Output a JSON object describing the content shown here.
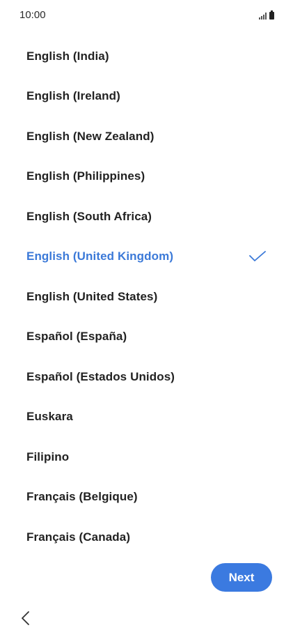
{
  "status_bar": {
    "time": "10:00",
    "icons": [
      "signal-icon",
      "battery-icon"
    ]
  },
  "languages": {
    "items": [
      {
        "label": "English (India)",
        "selected": false
      },
      {
        "label": "English (Ireland)",
        "selected": false
      },
      {
        "label": "English (New Zealand)",
        "selected": false
      },
      {
        "label": "English (Philippines)",
        "selected": false
      },
      {
        "label": "English (South Africa)",
        "selected": false
      },
      {
        "label": "English (United Kingdom)",
        "selected": true
      },
      {
        "label": "English (United States)",
        "selected": false
      },
      {
        "label": "Español (España)",
        "selected": false
      },
      {
        "label": "Español (Estados Unidos)",
        "selected": false
      },
      {
        "label": "Euskara",
        "selected": false
      },
      {
        "label": "Filipino",
        "selected": false
      },
      {
        "label": "Français (Belgique)",
        "selected": false
      },
      {
        "label": "Français (Canada)",
        "selected": false
      }
    ]
  },
  "footer": {
    "next_label": "Next",
    "back_icon": "chevron-left-icon"
  },
  "colors": {
    "accent": "#3b79d8",
    "button_bg": "#3b7ae0",
    "text": "#222222",
    "background": "#ffffff"
  }
}
